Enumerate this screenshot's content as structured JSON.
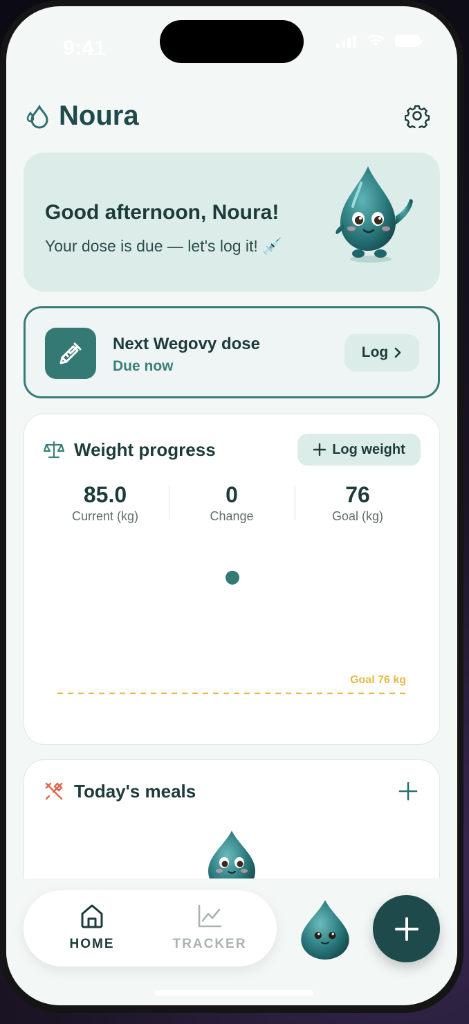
{
  "status_bar": {
    "time": "9:41"
  },
  "header": {
    "app_name": "Noura",
    "brand_icon": "water-drop-icon",
    "settings_icon": "gear-icon"
  },
  "greeting": {
    "title": "Good afternoon, Noura!",
    "subtitle": "Your dose is due — let's log it! 💉"
  },
  "dose": {
    "title": "Next Wegovy dose",
    "status": "Due now",
    "button_label": "Log",
    "icon": "syringe-icon"
  },
  "weight": {
    "title": "Weight progress",
    "log_button": "Log weight",
    "stats": [
      {
        "value": "85.0",
        "label": "Current (kg)"
      },
      {
        "value": "0",
        "label": "Change"
      },
      {
        "value": "76",
        "label": "Goal (kg)"
      }
    ]
  },
  "chart_data": {
    "type": "scatter",
    "title": "",
    "xlabel": "",
    "ylabel": "",
    "points": [
      {
        "y": 85.0
      }
    ],
    "goal_line": {
      "value": 76,
      "label": "Goal 76 kg"
    },
    "colors": {
      "point": "#357975",
      "goal": "#e8b84a"
    },
    "grid": false
  },
  "meals": {
    "title": "Today's meals",
    "icon": "utensils-icon",
    "add_icon": "plus-icon"
  },
  "tabbar": {
    "tabs": [
      {
        "label": "HOME",
        "icon": "home-icon",
        "active": true
      },
      {
        "label": "TRACKER",
        "icon": "chart-line-icon",
        "active": false
      }
    ],
    "fab_icon": "plus-icon"
  },
  "colors": {
    "primary": "#1e4a4c",
    "accent": "#357975",
    "card_tint": "#dcede9",
    "goal": "#e8b84a",
    "meals_icon": "#e0664a"
  }
}
